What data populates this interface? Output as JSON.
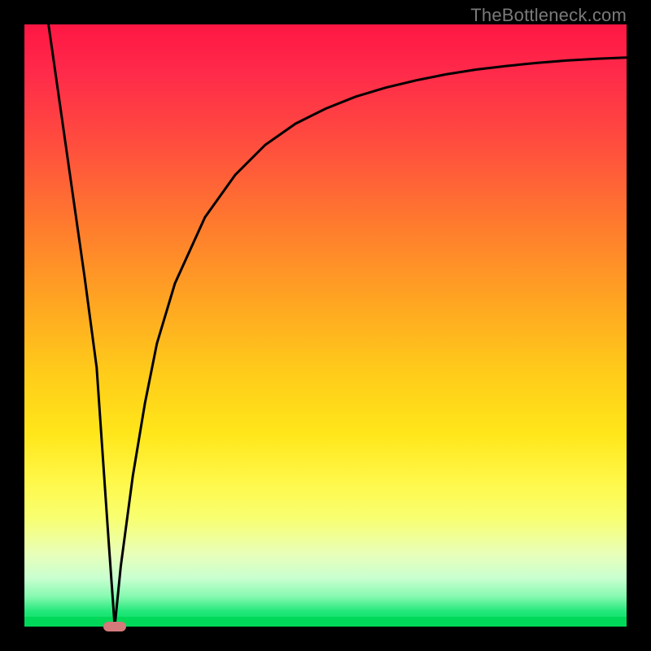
{
  "watermark": {
    "text": "TheBottleneck.com"
  },
  "colors": {
    "frame": "#000000",
    "gradient_top": "#ff1744",
    "gradient_bottom": "#00d85a",
    "curve": "#000000",
    "marker_fill": "#d47a7a"
  },
  "chart_data": {
    "type": "line",
    "title": "",
    "xlabel": "",
    "ylabel": "",
    "xlim": [
      0,
      100
    ],
    "ylim": [
      0,
      100
    ],
    "grid": false,
    "legend": false,
    "annotations": [
      {
        "name": "min-marker",
        "x": 15,
        "y": 0,
        "shape": "pill",
        "color": "#d47a7a"
      }
    ],
    "series": [
      {
        "name": "bottleneck-curve",
        "x": [
          4,
          6,
          8,
          10,
          12,
          14,
          15,
          16,
          18,
          20,
          22,
          25,
          30,
          35,
          40,
          45,
          50,
          55,
          60,
          65,
          70,
          75,
          80,
          85,
          90,
          95,
          100
        ],
        "values": [
          100,
          86,
          72,
          58,
          43,
          14,
          0,
          10,
          25,
          37,
          47,
          57,
          68,
          75,
          80,
          83.5,
          86,
          88,
          89.5,
          90.7,
          91.7,
          92.5,
          93.1,
          93.6,
          94,
          94.3,
          94.5
        ]
      }
    ]
  }
}
